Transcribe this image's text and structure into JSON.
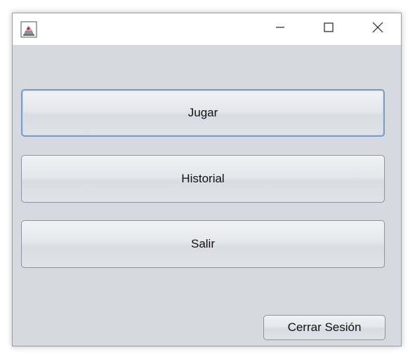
{
  "window": {
    "app_icon": "java-coffee-cup-icon",
    "controls": {
      "minimize_icon": "minimize-icon",
      "maximize_icon": "maximize-icon",
      "close_icon": "close-icon"
    }
  },
  "menu": {
    "play_label": "Jugar",
    "history_label": "Historial",
    "exit_label": "Salir",
    "logout_label": "Cerrar Sesión"
  },
  "colors": {
    "background": "#d6d9e0",
    "focus_border": "#7a9cc7",
    "button_border": "#8e949c"
  }
}
